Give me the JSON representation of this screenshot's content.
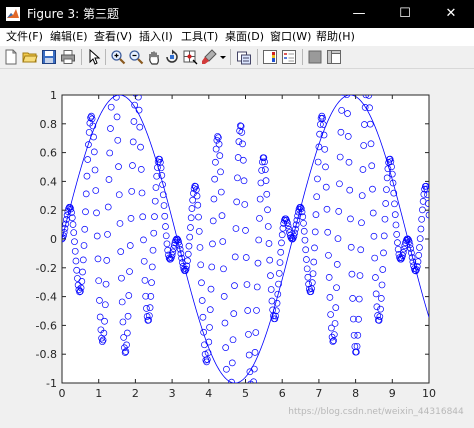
{
  "window": {
    "title": "Figure 3: 第三题",
    "controls": {
      "minimize": "—",
      "maximize": "☐",
      "close": "✕"
    }
  },
  "menu": [
    "文件(F)",
    "编辑(E)",
    "查看(V)",
    "插入(I)",
    "工具(T)",
    "桌面(D)",
    "窗口(W)",
    "帮助(H)"
  ],
  "toolbar_icons": [
    "new-file-icon",
    "open-folder-icon",
    "save-icon",
    "print-icon",
    "pointer-icon",
    "zoom-in-icon",
    "zoom-out-icon",
    "pan-hand-icon",
    "rotate-3d-icon",
    "data-cursor-icon",
    "brush-icon",
    "brush-dropdown-icon",
    "link-plot-icon",
    "colorbar-icon",
    "legend-icon",
    "hide-plot-tools-icon",
    "show-plot-tools-icon"
  ],
  "colors": {
    "series": "#0000ff",
    "titlebar": "#000000",
    "axes_bg": "#ffffff"
  },
  "watermark": "https://blog.csdn.net/weixin_44316844",
  "chart_data": {
    "type": "scatter",
    "title": "",
    "xlabel": "",
    "ylabel": "",
    "xlim": [
      0,
      10
    ],
    "ylim": [
      -1,
      1
    ],
    "xticks": [
      "0",
      "1",
      "2",
      "3",
      "4",
      "5",
      "6",
      "7",
      "8",
      "9",
      "10"
    ],
    "yticks": [
      "-1",
      "-0.8",
      "-0.6",
      "-0.4",
      "-0.2",
      "0",
      "0.2",
      "0.4",
      "0.6",
      "0.8",
      "1"
    ],
    "grid": false,
    "series": [
      {
        "style": "line",
        "expression": "sin(x)",
        "x_range": [
          0,
          10
        ]
      },
      {
        "style": "circle-markers",
        "expression": "sin(x)*sin(10x)+0.2*sin(x)",
        "x_range": [
          0,
          10
        ],
        "x_step": 0.02
      }
    ]
  }
}
